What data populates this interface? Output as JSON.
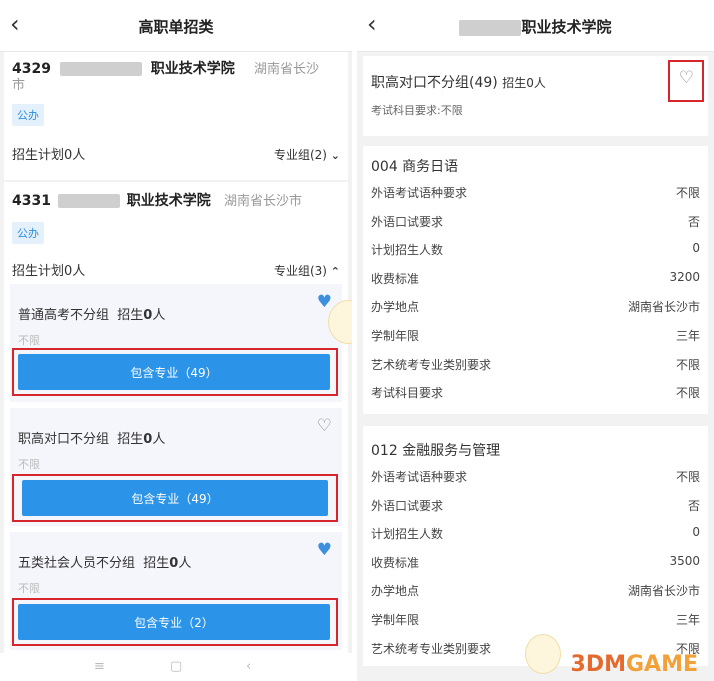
{
  "left": {
    "title": "高职单招类",
    "back_icon": "‹",
    "schools": [
      {
        "id_prefix": "4329",
        "name_suffix": "职业技术学院",
        "province_line1": "湖南省长沙",
        "province_line2": "市",
        "badge": "公办",
        "plan": "招生计划0人",
        "groups": "专业组(2)",
        "chevron": "⌄"
      },
      {
        "id_prefix": "4331",
        "name_suffix": "职业技术学院",
        "province": "湖南省长沙市",
        "badge": "公办",
        "plan": "招生计划0人",
        "groups": "专业组(3)",
        "chevron": "⌃",
        "subgroups": [
          {
            "name": "普通高考不分组",
            "admit_label": "招生",
            "admit_num": "0",
            "admit_unit": "人",
            "req": "不限",
            "button": "包含专业（49）",
            "favorited": true
          },
          {
            "name": "职高对口不分组",
            "admit_label": "招生",
            "admit_num": "0",
            "admit_unit": "人",
            "req": "不限",
            "button": "包含专业（49）",
            "favorited": false
          },
          {
            "name": "五类社会人员不分组",
            "admit_label": "招生",
            "admit_num": "0",
            "admit_unit": "人",
            "req": "不限",
            "button": "包含专业（2）",
            "favorited": true
          }
        ]
      }
    ],
    "nav": {
      "menu": "≡",
      "home": "▢",
      "back": "‹"
    }
  },
  "right": {
    "title_suffix": "职业技术学院",
    "back_icon": "‹",
    "group": {
      "name": "职高对口不分组(49)",
      "admit": "招生0人",
      "subject_req": "考试科目要求:不限"
    },
    "majors": [
      {
        "title": "004 商务日语",
        "rows": [
          {
            "k": "外语考试语种要求",
            "v": "不限"
          },
          {
            "k": "外语口试要求",
            "v": "否"
          },
          {
            "k": "计划招生人数",
            "v": "0"
          },
          {
            "k": "收费标准",
            "v": "3200"
          },
          {
            "k": "办学地点",
            "v": "湖南省长沙市"
          },
          {
            "k": "学制年限",
            "v": "三年"
          },
          {
            "k": "艺术统考专业类别要求",
            "v": "不限"
          },
          {
            "k": "考试科目要求",
            "v": "不限"
          }
        ]
      },
      {
        "title": "012 金融服务与管理",
        "rows": [
          {
            "k": "外语考试语种要求",
            "v": "不限"
          },
          {
            "k": "外语口试要求",
            "v": "否"
          },
          {
            "k": "计划招生人数",
            "v": "0"
          },
          {
            "k": "收费标准",
            "v": "3500"
          },
          {
            "k": "办学地点",
            "v": "湖南省长沙市"
          },
          {
            "k": "学制年限",
            "v": "三年"
          },
          {
            "k": "艺术统考专业类别要求",
            "v": "不限"
          }
        ]
      }
    ],
    "watermark_a": "3DM",
    "watermark_b": "GAME"
  },
  "colors": {
    "accent": "#2b94e8",
    "highlight_box": "#d7262b",
    "heart": "#3d8fe0"
  }
}
